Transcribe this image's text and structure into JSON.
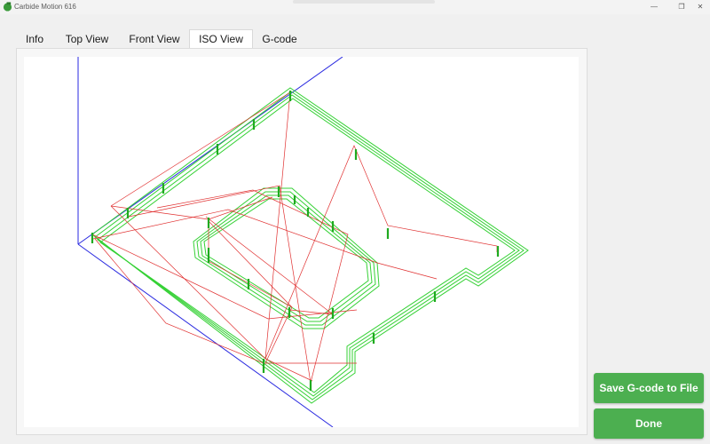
{
  "window": {
    "title": "Carbide Motion 616",
    "minimize_glyph": "—",
    "restore_glyph": "❐",
    "close_glyph": "✕"
  },
  "tabs": [
    {
      "label": "Info",
      "active": false
    },
    {
      "label": "Top View",
      "active": false
    },
    {
      "label": "Front View",
      "active": false
    },
    {
      "label": "ISO View",
      "active": true
    },
    {
      "label": "G-code",
      "active": false
    }
  ],
  "actions": {
    "save_label": "Save G-code to File",
    "done_label": "Done"
  },
  "colors": {
    "accent": "#4caf50",
    "cut_path": "#35d135",
    "rapid_move": "#e03030",
    "plunge": "#1faa1f",
    "axis": "#2a2ae0"
  },
  "icons": {
    "app": "carbide-motion-icon",
    "minimize": "minimize-icon",
    "restore": "restore-icon",
    "close": "close-icon"
  }
}
